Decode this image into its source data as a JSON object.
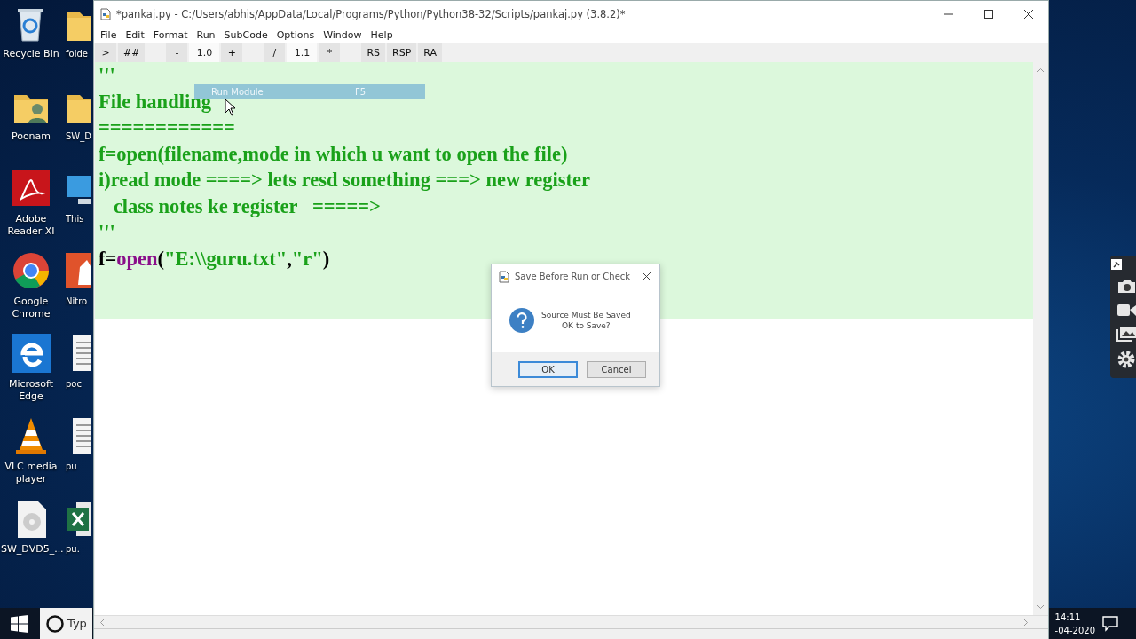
{
  "desktop": {
    "columns": [
      {
        "icons": [
          {
            "label": "Recycle Bin",
            "kind": "recycle"
          },
          {
            "label": "Poonam",
            "kind": "user-folder"
          },
          {
            "label": "Adobe Reader XI",
            "kind": "pdf"
          },
          {
            "label": "Google Chrome",
            "kind": "chrome"
          },
          {
            "label": "Microsoft Edge",
            "kind": "edge"
          },
          {
            "label": "VLC media player",
            "kind": "vlc"
          },
          {
            "label": "SW_DVD5_...",
            "kind": "disc"
          }
        ]
      },
      {
        "icons": [
          {
            "label": "folde",
            "kind": "folder"
          },
          {
            "label": "SW_D",
            "kind": "folder"
          },
          {
            "label": "This",
            "kind": "computer"
          },
          {
            "label": "Nitro",
            "kind": "nitro"
          },
          {
            "label": "poc",
            "kind": "document"
          },
          {
            "label": "pu",
            "kind": "document"
          },
          {
            "label": "pu.",
            "kind": "excel"
          }
        ]
      }
    ]
  },
  "taskbar": {
    "search": {
      "placeholder": "Typ"
    },
    "clock": {
      "time": "14:11",
      "date": "-04-2020"
    }
  },
  "window": {
    "title": "*pankaj.py - C:/Users/abhis/AppData/Local/Programs/Python/Python38-32/Scripts/pankaj.py (3.8.2)*",
    "menu": [
      "File",
      "Edit",
      "Format",
      "Run",
      "SubCode",
      "Options",
      "Window",
      "Help"
    ],
    "toolbar": [
      [
        {
          "label": ">",
          "kind": "button"
        },
        {
          "label": "##",
          "kind": "button"
        }
      ],
      [
        {
          "label": "-",
          "kind": "button"
        },
        {
          "label": "1.0",
          "kind": "field"
        },
        {
          "label": "+",
          "kind": "button"
        }
      ],
      [
        {
          "label": "/",
          "kind": "button"
        },
        {
          "label": "1.1",
          "kind": "field"
        },
        {
          "label": "*",
          "kind": "button"
        }
      ],
      [
        {
          "label": "RS",
          "kind": "button"
        },
        {
          "label": "RSP",
          "kind": "button"
        },
        {
          "label": "RA",
          "kind": "button"
        }
      ]
    ],
    "editor": {
      "lines": [
        [
          {
            "text": "'''",
            "kind": "string"
          }
        ],
        [
          {
            "text": "File handling",
            "kind": "string"
          }
        ],
        [
          {
            "text": "============",
            "kind": "string"
          }
        ],
        [
          {
            "text": "f=open(filename,mode in which u want to open the file)",
            "kind": "string"
          }
        ],
        [
          {
            "text": "i)read mode ====> lets resd something ===> new register",
            "kind": "string"
          }
        ],
        [
          {
            "text": "   class notes ke register   =====>",
            "kind": "string"
          }
        ],
        [
          {
            "text": "'''",
            "kind": "string"
          }
        ],
        [
          {
            "text": "f=",
            "kind": "plain"
          },
          {
            "text": "open",
            "kind": "builtin"
          },
          {
            "text": "(",
            "kind": "plain"
          },
          {
            "text": "\"E:\\\\guru.txt\"",
            "kind": "string"
          },
          {
            "text": ",",
            "kind": "plain"
          },
          {
            "text": "\"r\"",
            "kind": "string"
          },
          {
            "text": ")",
            "kind": "plain"
          }
        ]
      ]
    },
    "menu_item": {
      "label": "Run Module",
      "shortcut": "F5"
    }
  },
  "dialog": {
    "title": "Save Before Run or Check",
    "message": [
      "Source Must Be Saved",
      "OK to Save?"
    ],
    "buttons": [
      {
        "label": "OK",
        "selected": true
      },
      {
        "label": "Cancel",
        "selected": false
      }
    ]
  }
}
